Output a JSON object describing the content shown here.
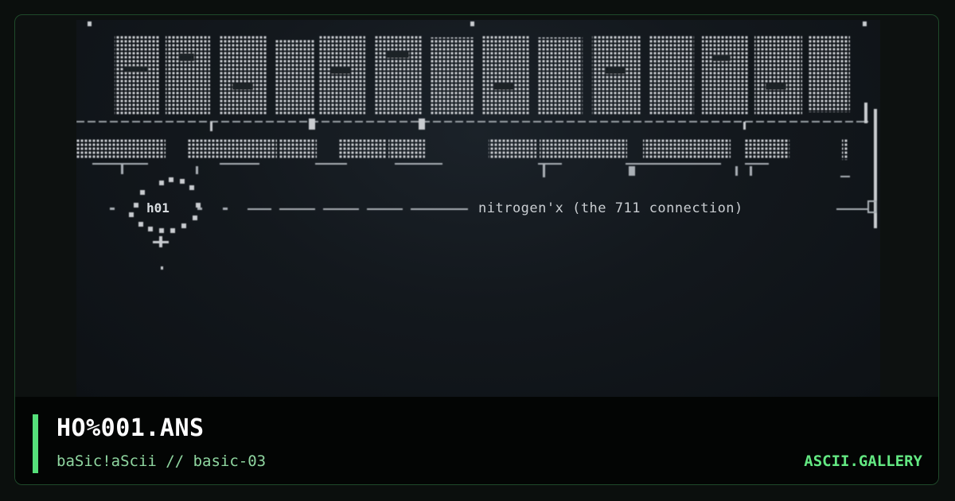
{
  "artwork": {
    "caption": "nitrogen'x (the 711 connection)",
    "tag": "h01",
    "logo_blocks": 14
  },
  "footer": {
    "title": "HO%001.ANS",
    "subtitle": "baSic!aScii // basic-03",
    "brand": "ASCII.GALLERY"
  },
  "colors": {
    "accent": "#55e07a",
    "brand": "#63e882",
    "subtitle": "#8fd6a0",
    "art_fg": "#c9cdd1",
    "background": "#0b0f0d"
  }
}
